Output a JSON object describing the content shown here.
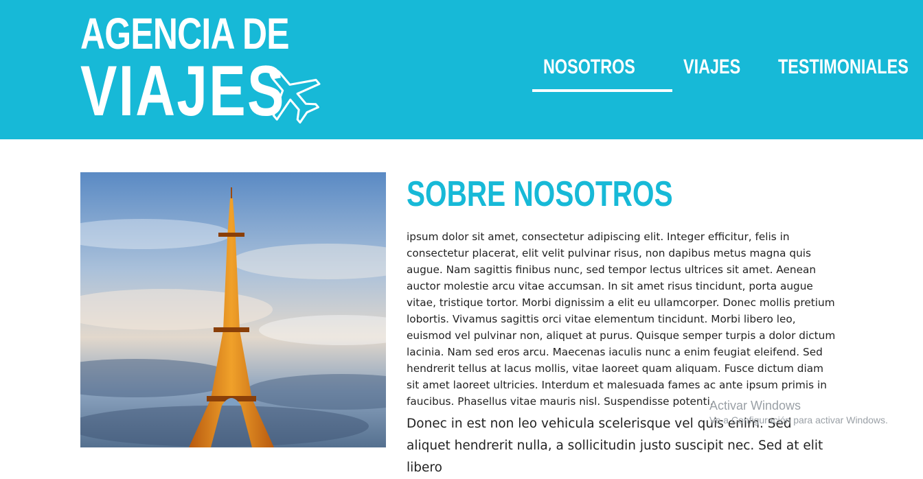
{
  "header": {
    "logo_line1": "AGENCIA DE",
    "logo_line2": "VIAJES",
    "logo_icon": "airplane-icon",
    "background_color": "#17b9d7"
  },
  "nav": {
    "items": [
      {
        "label": "NOSOTROS",
        "active": true
      },
      {
        "label": "VIAJES",
        "active": false
      },
      {
        "label": "TESTIMONIALES",
        "active": false
      }
    ]
  },
  "main": {
    "image": "eiffel-tower-photo",
    "heading": "SOBRE NOSOTROS",
    "paragraph1": "ipsum dolor sit amet, consectetur adipiscing elit. Integer efficitur, felis in consectetur placerat, elit velit pulvinar risus, non dapibus metus magna quis augue. Nam sagittis finibus nunc, sed tempor lectus ultrices sit amet. Aenean auctor molestie arcu vitae accumsan. In sit amet risus tincidunt, porta augue vitae, tristique tortor. Morbi dignissim a elit eu ullamcorper. Donec mollis pretium lobortis. Vivamus sagittis orci vitae elementum tincidunt. Morbi libero leo, euismod vel pulvinar non, aliquet at purus. Quisque semper turpis a dolor dictum lacinia. Nam sed eros arcu. Maecenas iaculis nunc a enim feugiat eleifend. Sed hendrerit tellus at lacus mollis, vitae laoreet quam aliquam. Fusce dictum diam sit amet laoreet ultricies. Interdum et malesuada fames ac ante ipsum primis in faucibus. Phasellus vitae mauris nisl. Suspendisse potenti.",
    "paragraph2": "Donec in est non leo vehicula scelerisque vel quis enim. Sed aliquet hendrerit nulla, a sollicitudin justo suscipit nec. Sed at elit libero",
    "accent_color": "#17b9d7"
  },
  "watermark": {
    "title": "Activar Windows",
    "subtitle": "Ve a Configuración para activar Windows."
  }
}
